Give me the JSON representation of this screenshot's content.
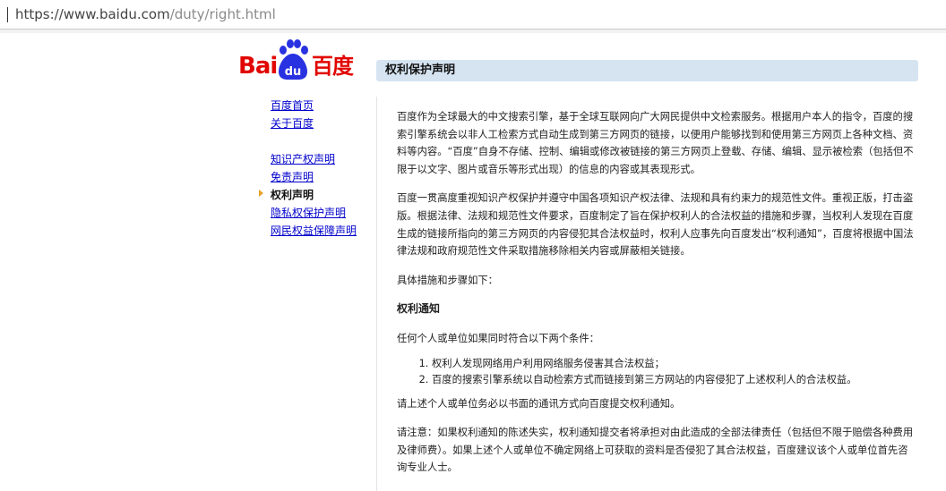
{
  "browser": {
    "url_prefix": "https://www.baidu.com",
    "url_path": "/duty/right.html"
  },
  "logo": {
    "bai": "Bai",
    "du": "du",
    "cn": "百度"
  },
  "page": {
    "title": "权利保护声明"
  },
  "sidebar": {
    "items": [
      {
        "label": "百度首页",
        "current": false
      },
      {
        "label": "关于百度",
        "current": false
      },
      {
        "label": "知识产权声明",
        "current": false
      },
      {
        "label": "免责声明",
        "current": false
      },
      {
        "label": "权利声明",
        "current": true
      },
      {
        "label": "隐私权保护声明",
        "current": false
      },
      {
        "label": "网民权益保障声明",
        "current": false
      }
    ]
  },
  "content": {
    "p1": "百度作为全球最大的中文搜索引擎，基于全球互联网向广大网民提供中文检索服务。根据用户本人的指令，百度的搜索引擎系统会以非人工检索方式自动生成到第三方网页的链接，以便用户能够找到和使用第三方网页上各种文档、资料等内容。“百度”自身不存储、控制、编辑或修改被链接的第三方网页上登载、存储、编辑、显示被检索（包括但不限于以文字、图片或音乐等形式出现）的信息的内容或其表现形式。",
    "p2": "百度一贯高度重视知识产权保护并遵守中国各项知识产权法律、法规和具有约束力的规范性文件。重视正版，打击盗版。根据法律、法规和规范性文件要求，百度制定了旨在保护权利人的合法权益的措施和步骤，当权利人发现在百度生成的链接所指向的第三方网页的内容侵犯其合法权益时，权利人应事先向百度发出“权利通知”，百度将根据中国法律法规和政府规范性文件采取措施移除相关内容或屏蔽相关链接。",
    "p3": "具体措施和步骤如下：",
    "h1": "权利通知",
    "p4": "任何个人或单位如果同时符合以下两个条件：",
    "list": [
      "权利人发现网络用户利用网络服务侵害其合法权益；",
      "百度的搜索引擎系统以自动检索方式而链接到第三方网站的内容侵犯了上述权利人的合法权益。"
    ],
    "p5": "请上述个人或单位务必以书面的通讯方式向百度提交权利通知。",
    "p6": "请注意：如果权利通知的陈述失实，权利通知提交者将承担对由此造成的全部法律责任（包括但不限于赔偿各种费用及律师费）。如果上述个人或单位不确定网络上可获取的资料是否侵犯了其合法权益，百度建议该个人或单位首先咨询专业人士。"
  },
  "colors": {
    "brand_red": "#e10601",
    "paw_blue": "#2932e1",
    "title_bar": "#d6e4f2",
    "link": "#0000cc",
    "arrow": "#e8a126"
  }
}
